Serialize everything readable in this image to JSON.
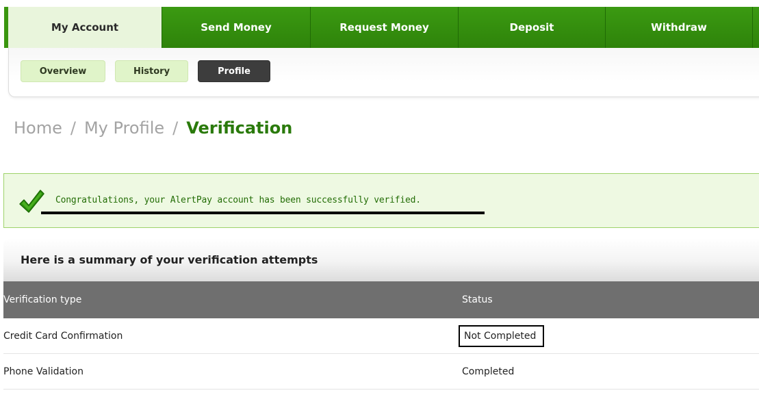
{
  "main_tabs": [
    {
      "label": "My Account",
      "active": true
    },
    {
      "label": "Send Money",
      "active": false
    },
    {
      "label": "Request Money",
      "active": false
    },
    {
      "label": "Deposit",
      "active": false
    },
    {
      "label": "Withdraw",
      "active": false
    }
  ],
  "sub_nav": [
    {
      "label": "Overview",
      "active": false
    },
    {
      "label": "History",
      "active": false
    },
    {
      "label": "Profile",
      "active": true
    }
  ],
  "breadcrumb": {
    "home": "Home",
    "sep1": "/",
    "profile": "My Profile",
    "sep2": "/",
    "current": "Verification"
  },
  "banner": {
    "icon": "checkmark-icon",
    "message": "Congratulations, your AlertPay account has been successfully verified."
  },
  "summary": {
    "title": "Here is a summary of your verification attempts",
    "columns": [
      "Verification type",
      "Status"
    ],
    "rows": [
      {
        "type": "Credit Card Confirmation",
        "status": "Not Completed"
      },
      {
        "type": "Phone Validation",
        "status": "Completed"
      }
    ]
  },
  "colors": {
    "brand_green": "#2e830a",
    "active_tab_bg": "#e9f5dc",
    "header_gray": "#6f6f6f",
    "success_text": "#236d06"
  }
}
